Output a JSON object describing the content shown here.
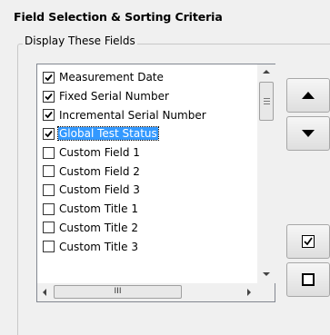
{
  "section_title": "Field Selection & Sorting Criteria",
  "group_label": "Display These Fields",
  "fields": [
    {
      "label": "Measurement Date",
      "checked": true,
      "selected": false
    },
    {
      "label": "Fixed Serial Number",
      "checked": true,
      "selected": false
    },
    {
      "label": "Incremental Serial Number",
      "checked": true,
      "selected": false
    },
    {
      "label": "Global Test Status",
      "checked": true,
      "selected": true
    },
    {
      "label": "Custom Field 1",
      "checked": false,
      "selected": false
    },
    {
      "label": "Custom Field 2",
      "checked": false,
      "selected": false
    },
    {
      "label": "Custom Field 3",
      "checked": false,
      "selected": false
    },
    {
      "label": "Custom Title 1",
      "checked": false,
      "selected": false
    },
    {
      "label": "Custom Title 2",
      "checked": false,
      "selected": false
    },
    {
      "label": "Custom Title 3",
      "checked": false,
      "selected": false
    }
  ],
  "buttons": {
    "move_up": "triangle-up-icon",
    "move_down": "triangle-down-icon",
    "check_all": "checked-box-icon",
    "uncheck_all": "empty-box-icon"
  },
  "hscroll_thumb_grip": "III",
  "colors": {
    "selection": "#3399ff",
    "window_bg": "#f0f0f0"
  }
}
